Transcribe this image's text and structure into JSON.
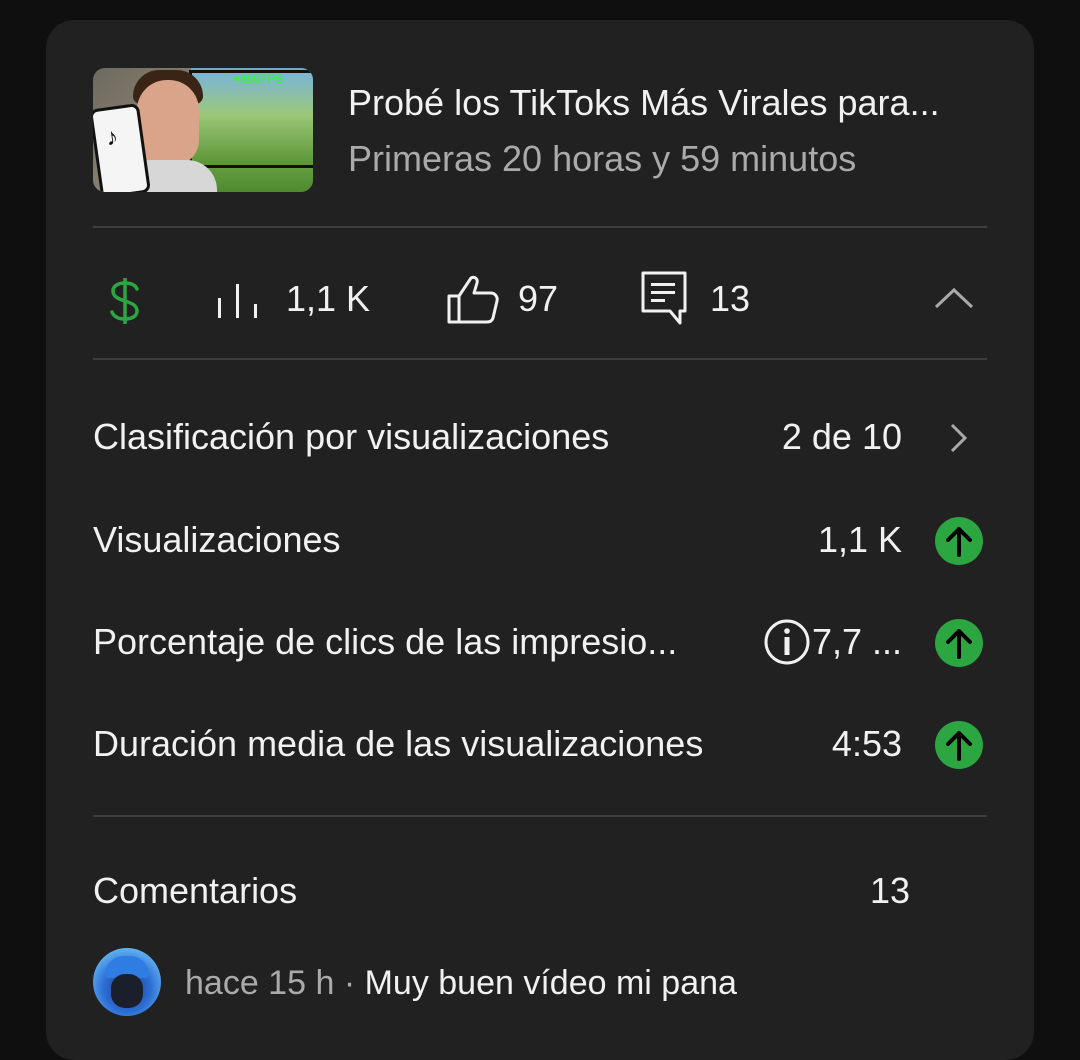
{
  "video": {
    "title": "Probé los TikToks Más Virales para...",
    "subtitle": "Primeras 20 horas y 59 minutos",
    "thumbnail_text": "+800FPS",
    "thumbnail_phone_brand": "TikTok"
  },
  "stats": {
    "revenue_icon": "dollar-icon",
    "views_icon": "bar-chart-icon",
    "views": "1,1 K",
    "likes_icon": "thumbs-up-icon",
    "likes": "97",
    "comments_icon": "comment-icon",
    "comments": "13",
    "collapse_icon": "chevron-up-icon"
  },
  "metrics": [
    {
      "label": "Clasificación por visualizaciones",
      "value": "2 de 10",
      "trailing": "chevron-right-icon"
    },
    {
      "label": "Visualizaciones",
      "value": "1,1 K",
      "trailing": "arrow-up-circle-icon"
    },
    {
      "label": "Porcentaje de clics de las impresio...",
      "value": "7,7 ...",
      "info_icon": "info-icon",
      "trailing": "arrow-up-circle-icon"
    },
    {
      "label": "Duración media de las visualizaciones",
      "value": "4:53",
      "trailing": "arrow-up-circle-icon"
    }
  ],
  "comments_section": {
    "label": "Comentarios",
    "count": "13",
    "first_comment": {
      "time": "hace 15 h",
      "separator": "·",
      "text": "Muy buen vídeo mi pana"
    }
  },
  "colors": {
    "card_bg": "#212121",
    "page_bg": "#0f0f0f",
    "accent_green": "#2ba640",
    "dollar_green": "#2ba640",
    "secondary_text": "#aaaaaa"
  }
}
